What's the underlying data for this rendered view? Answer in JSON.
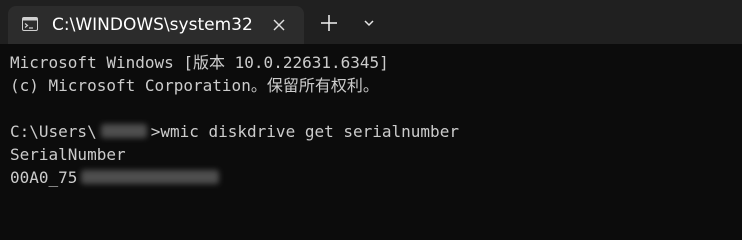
{
  "tab": {
    "title": "C:\\WINDOWS\\system32",
    "close_glyph": "×",
    "icon": "terminal-icon"
  },
  "toolbar": {
    "new_tab_glyph": "+",
    "dropdown_glyph": "⌄"
  },
  "console": {
    "line1": "Microsoft Windows [版本 10.0.22631.6345]",
    "line2": "(c) Microsoft Corporation。保留所有权利。",
    "prompt_prefix": "C:\\Users\\",
    "prompt_suffix": ">wmic diskdrive get serialnumber",
    "output_header": "SerialNumber",
    "serial_prefix": "00A0_75"
  },
  "colors": {
    "background": "#0c0c0c",
    "tabbar": "#202020",
    "active_tab": "#2c2c2c",
    "text": "#cccccc"
  }
}
